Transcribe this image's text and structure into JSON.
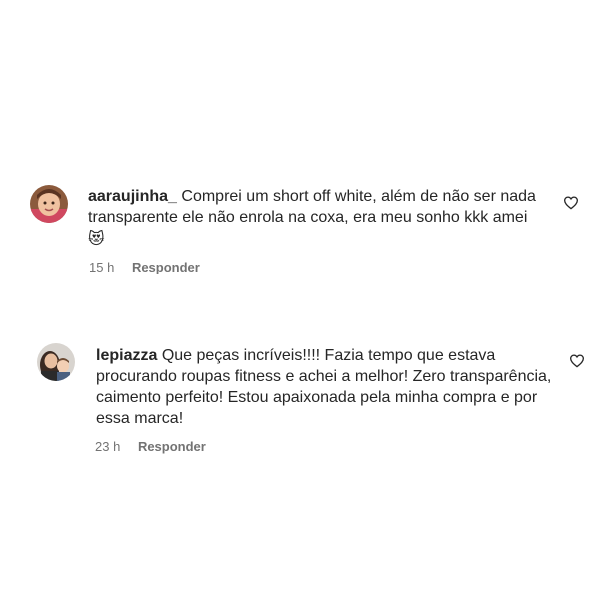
{
  "comments": [
    {
      "username": "aaraujinha_",
      "text": "Comprei um short off white, além de não ser nada transparente ele não enrola na coxa, era meu sonho kkk amei",
      "emoji": "😻",
      "time": "15 h",
      "reply_label": "Responder",
      "like_icon": "heart-outline-icon"
    },
    {
      "username": "lepiazza",
      "text": "Que peças incríveis!!!! Fazia tempo que estava procurando roupas fitness e achei a melhor! Zero transparência, caimento perfeito! Estou apaixonada pela minha compra e por essa marca!",
      "time": "23 h",
      "reply_label": "Responder",
      "like_icon": "heart-outline-icon"
    }
  ]
}
